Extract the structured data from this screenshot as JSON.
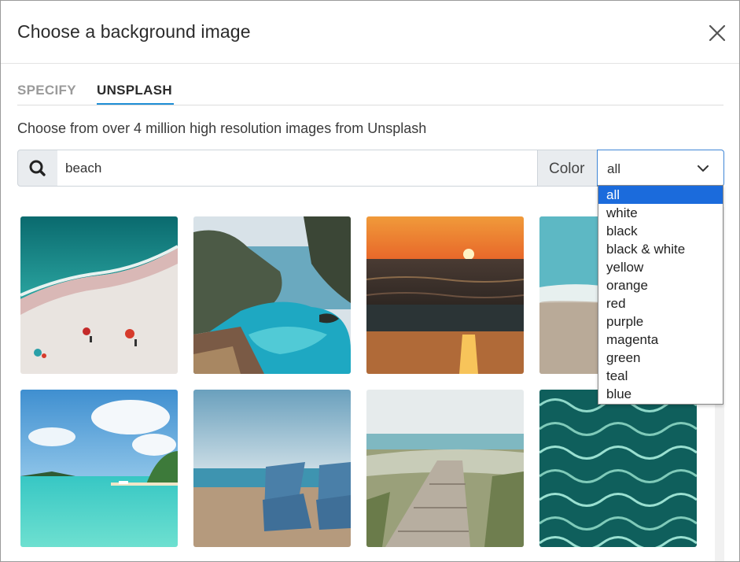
{
  "dialog": {
    "title": "Choose a background image",
    "close_icon": "close-icon"
  },
  "tabs": [
    {
      "label": "SPECIFY",
      "active": false
    },
    {
      "label": "UNSPLASH",
      "active": true
    }
  ],
  "description": "Choose from over 4 million high resolution images from Unsplash",
  "search": {
    "icon": "search-icon",
    "value": "beach",
    "placeholder": ""
  },
  "color_filter": {
    "label": "Color",
    "selected": "all",
    "options": [
      "all",
      "white",
      "black",
      "black & white",
      "yellow",
      "orange",
      "red",
      "purple",
      "magenta",
      "green",
      "teal",
      "blue"
    ]
  },
  "colors": {
    "accent": "#1f8fd6",
    "selected_option": "#1b6bdc",
    "addon_bg": "#e9ecef"
  },
  "images": [
    {
      "subject": "aerial beach with people and umbrellas"
    },
    {
      "subject": "coastal cove with waterfall"
    },
    {
      "subject": "sunset over ocean"
    },
    {
      "subject": "gentle waves on shore"
    },
    {
      "subject": "tropical island lagoon"
    },
    {
      "subject": "blue beach chairs on sand"
    },
    {
      "subject": "wooden boardwalk to sea"
    },
    {
      "subject": "rippling turquoise water"
    }
  ]
}
